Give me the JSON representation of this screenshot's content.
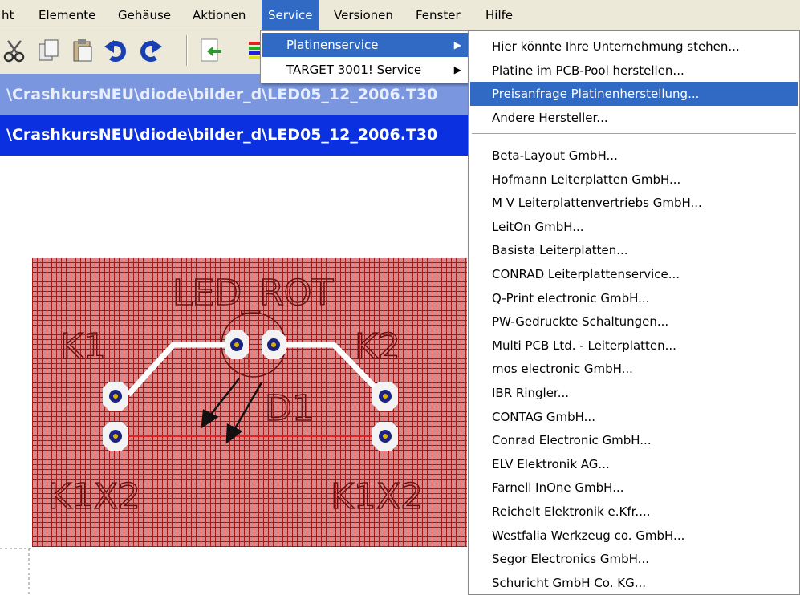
{
  "menubar": {
    "items": [
      "ht",
      "Elemente",
      "Gehäuse",
      "Aktionen",
      "Service",
      "Versionen",
      "Fenster",
      "Hilfe"
    ],
    "active": "Service"
  },
  "toolbar": {
    "icons": [
      "cut-icon",
      "copy-icon",
      "paste-icon",
      "undo-icon",
      "redo-icon",
      "import-icon",
      "layers-icon"
    ]
  },
  "windows": {
    "inactive_title": "\\CrashkursNEU\\diode\\bilder_d\\LED05_12_2006.T30",
    "active_title": "\\CrashkursNEU\\diode\\bilder_d\\LED05_12_2006.T30"
  },
  "pcb": {
    "labels": {
      "component_value": "LED_ROT",
      "pad_left": "K1",
      "pad_right": "K2",
      "designator": "D1",
      "connector_left": "K1X2",
      "connector_right": "K1X2"
    },
    "colors": {
      "board": "#d28a8a",
      "grid": "#a71818",
      "pad": "#1a237e",
      "trace": "#ffffff"
    }
  },
  "service_menu": {
    "items": [
      {
        "label": "Platinenservice",
        "submenu": true,
        "highlighted": true
      },
      {
        "label": "TARGET 3001! Service",
        "submenu": true,
        "highlighted": false
      }
    ]
  },
  "platinenservice_menu": {
    "group1": [
      "Hier könnte Ihre Unternehmung stehen...",
      "Platine im PCB-Pool herstellen...",
      "Preisanfrage Platinenherstellung...",
      "Andere Hersteller..."
    ],
    "highlighted": "Preisanfrage Platinenherstellung...",
    "group2": [
      "Beta-Layout GmbH...",
      "Hofmann Leiterplatten GmbH...",
      "M  V Leiterplattenvertriebs GmbH...",
      "LeitOn GmbH...",
      "Basista Leiterplatten...",
      "CONRAD Leiterplattenservice...",
      "Q-Print electronic GmbH...",
      "PW-Gedruckte Schaltungen...",
      "Multi PCB Ltd. - Leiterplatten...",
      "mos electronic GmbH...",
      "IBR Ringler...",
      "CONTAG GmbH...",
      "Conrad Electronic GmbH...",
      "ELV Elektronik AG...",
      "Farnell InOne GmbH...",
      "Reichelt Elektronik e.Kfr....",
      "Westfalia Werkzeug co. GmbH...",
      "Segor Electronics GmbH...",
      "Schuricht GmbH  Co. KG..."
    ]
  }
}
